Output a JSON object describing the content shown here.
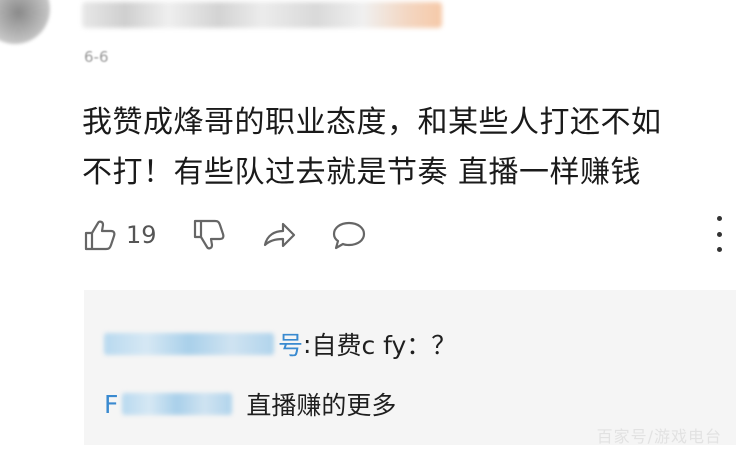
{
  "comment": {
    "time": "6-6",
    "line1": "我赞成烽哥的职业态度，和某些人打还不如",
    "line2": "不打！有些队过去就是节奏 直播一样赚钱",
    "like_count": "19"
  },
  "replies": [
    {
      "name_tail": "号",
      "separator": ":",
      "text": " 自费c fy：？"
    },
    {
      "name_head": "F",
      "text": "直播赚的更多"
    }
  ],
  "watermark": "百家号/游戏电台",
  "colors": {
    "accent_blue": "#3a8ad0",
    "reply_bg": "#f5f5f5",
    "icon_gray": "#666666"
  },
  "icons": [
    "thumb-up-icon",
    "thumb-down-icon",
    "share-arrow-icon",
    "comment-bubble-icon",
    "more-vertical-icon"
  ]
}
